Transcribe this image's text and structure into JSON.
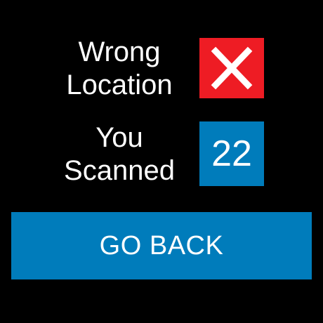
{
  "location": {
    "label_line1": "Wrong",
    "label_line2": "Location",
    "status_icon": "x-mark-icon"
  },
  "scanned": {
    "label_line1": "You",
    "label_line2": "Scanned",
    "count": "22"
  },
  "actions": {
    "go_back_label": "GO BACK"
  },
  "colors": {
    "background": "#000000",
    "error": "#ee1c24",
    "accent": "#007cbb",
    "text": "#ffffff"
  }
}
